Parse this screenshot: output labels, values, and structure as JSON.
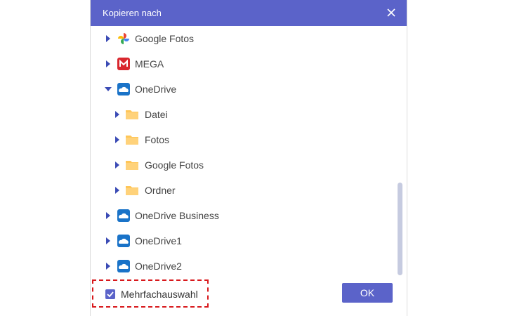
{
  "dialog": {
    "title": "Kopieren nach"
  },
  "tree": {
    "items": [
      {
        "label": "Google Fotos",
        "icon": "google-photos-icon",
        "expanded": false
      },
      {
        "label": "MEGA",
        "icon": "mega-icon",
        "expanded": false
      },
      {
        "label": "OneDrive",
        "icon": "onedrive-icon",
        "expanded": true
      },
      {
        "label": "Datei",
        "icon": "folder-icon",
        "expanded": false
      },
      {
        "label": "Fotos",
        "icon": "folder-icon",
        "expanded": false
      },
      {
        "label": "Google Fotos",
        "icon": "folder-icon",
        "expanded": false
      },
      {
        "label": "Ordner",
        "icon": "folder-icon",
        "expanded": false
      },
      {
        "label": "OneDrive Business",
        "icon": "onedrive-icon",
        "expanded": false
      },
      {
        "label": "OneDrive1",
        "icon": "onedrive-icon",
        "expanded": false
      },
      {
        "label": "OneDrive2",
        "icon": "onedrive-icon",
        "expanded": false
      }
    ]
  },
  "footer": {
    "multi_select_label": "Mehrfachauswahl",
    "multi_select_checked": true,
    "ok_label": "OK"
  },
  "colors": {
    "accent": "#5b63c9",
    "highlight_border": "#d8181c"
  }
}
